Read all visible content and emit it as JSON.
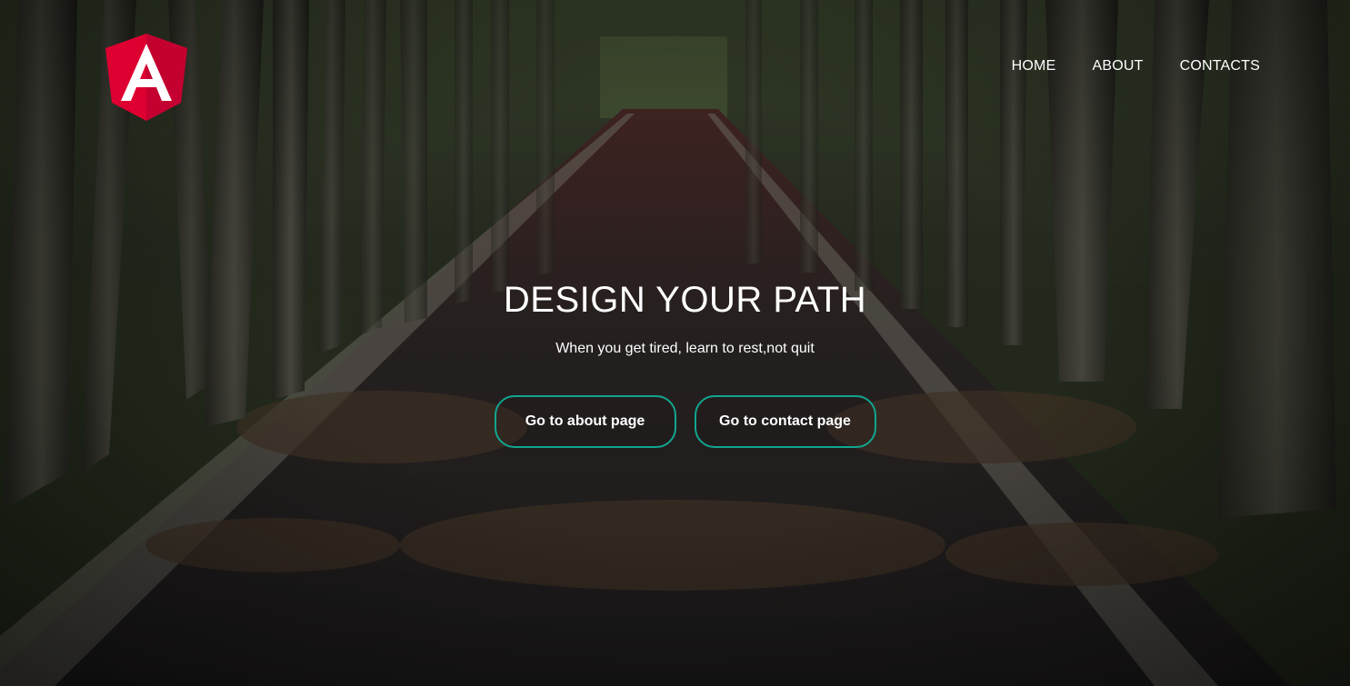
{
  "brand": {
    "logo_letter": "A",
    "logo_color": "#dd0031",
    "logo_shade": "#c3002f"
  },
  "nav": {
    "items": [
      {
        "label": "HOME"
      },
      {
        "label": "ABOUT"
      },
      {
        "label": "CONTACTS"
      }
    ]
  },
  "hero": {
    "title": "DESIGN YOUR PATH",
    "subtitle": "When you get tired, learn to rest,not quit",
    "buttons": [
      {
        "label": "Go to about page"
      },
      {
        "label": "Go to contact page"
      }
    ],
    "accent_color": "#12a58f",
    "background_image": "forest-path-photo"
  }
}
